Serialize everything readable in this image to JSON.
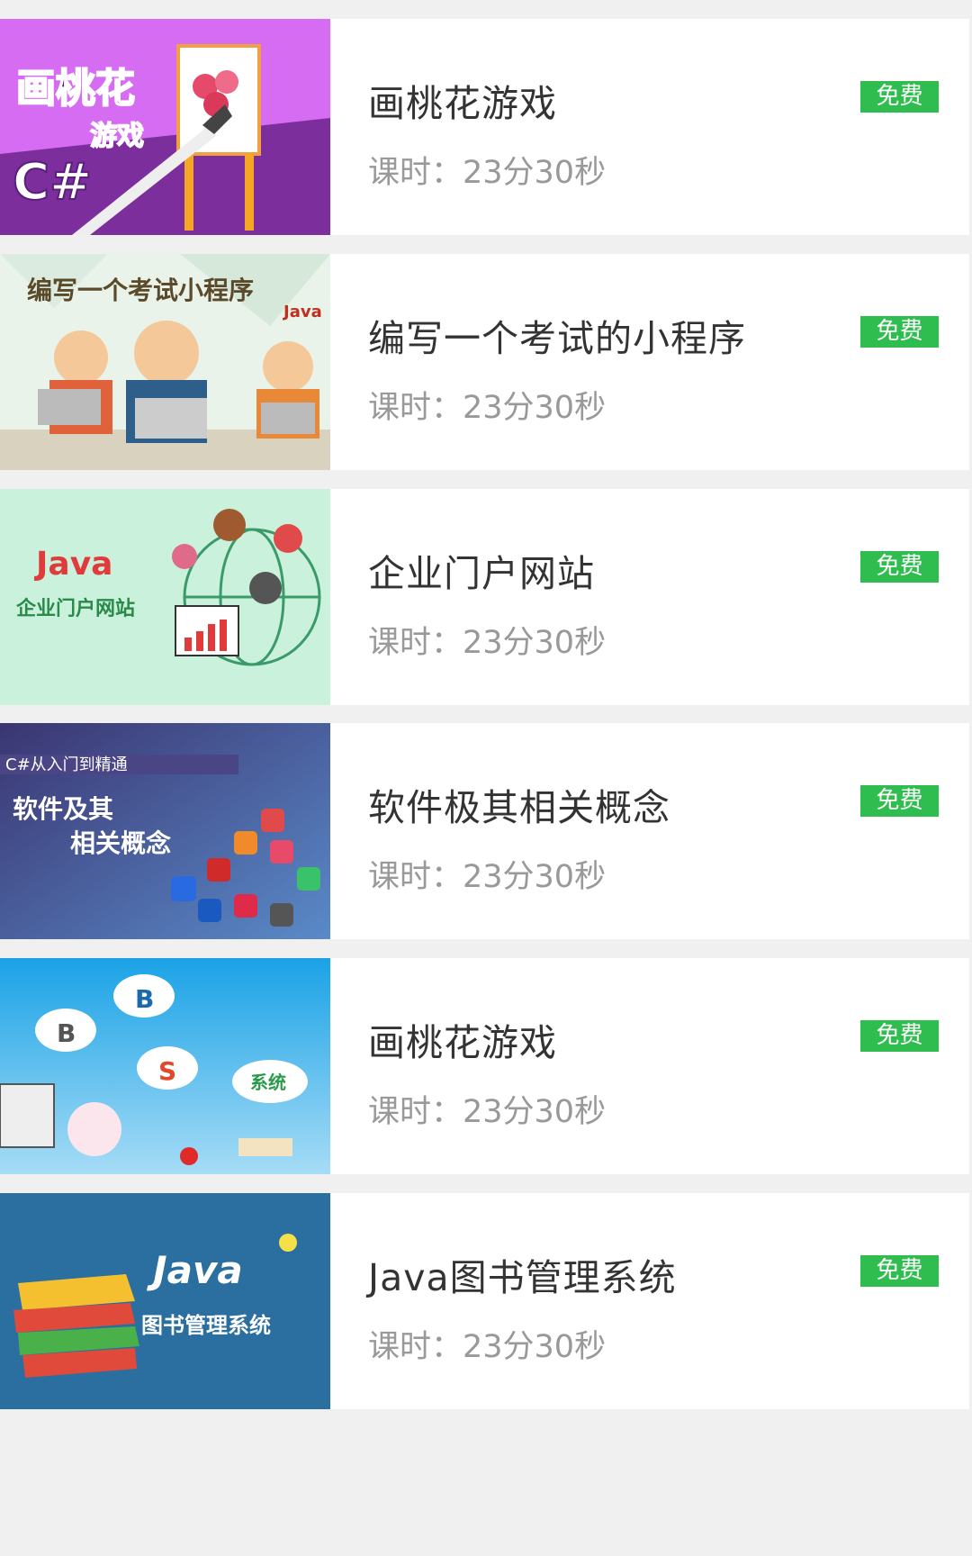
{
  "courses": [
    {
      "title": "画桃花游戏",
      "duration": "课时：23分30秒",
      "badge": "免费",
      "cover": {
        "lines": [
          "画桃花",
          "游戏",
          "C#"
        ],
        "bg": "#d36bf0",
        "bg2": "#7c2f9e"
      }
    },
    {
      "title": "编写一个考试的小程序",
      "duration": "课时：23分30秒",
      "badge": "免费",
      "cover": {
        "lines": [
          "编写一个考试小程序",
          "Java"
        ],
        "bg": "#e8f3ea",
        "bg2": "#cfe3d3"
      }
    },
    {
      "title": "企业门户网站",
      "duration": "课时：23分30秒",
      "badge": "免费",
      "cover": {
        "lines": [
          "Java",
          "企业门户网站"
        ],
        "bg": "#c9f1dc",
        "bg2": "#b6e9cf"
      }
    },
    {
      "title": "软件极其相关概念",
      "duration": "课时：23分30秒",
      "badge": "免费",
      "cover": {
        "lines": [
          "C#从入门到精通",
          "软件及其",
          "相关概念"
        ],
        "bg": "#3e3a78",
        "bg2": "#6aa0d8"
      }
    },
    {
      "title": "画桃花游戏",
      "duration": "课时：23分30秒",
      "badge": "免费",
      "cover": {
        "lines": [
          "B",
          "B",
          "S",
          "系统"
        ],
        "bg": "#2aa8e8",
        "bg2": "#8fd3f6"
      }
    },
    {
      "title": "Java图书管理系统",
      "duration": "课时：23分30秒",
      "badge": "免费",
      "cover": {
        "lines": [
          "Java",
          "图书管理系统"
        ],
        "bg": "#2a6fa0",
        "bg2": "#1f5a86"
      }
    }
  ],
  "colors": {
    "badge": "#2ebd4e",
    "title": "#333333",
    "meta": "#999999",
    "page_bg": "#f0f0f0"
  }
}
